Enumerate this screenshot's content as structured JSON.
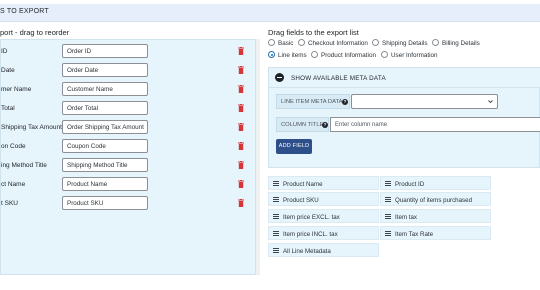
{
  "header": {
    "title": "S TO EXPORT"
  },
  "left": {
    "title": "port - drag to reorder",
    "rows": [
      {
        "label": "ID",
        "value": "Order ID"
      },
      {
        "label": "Date",
        "value": "Order Date"
      },
      {
        "label": "mer Name",
        "value": "Customer Name"
      },
      {
        "label": "Total",
        "value": "Order Total"
      },
      {
        "label": "Shipping Tax Amount",
        "value": "Order Shipping Tax Amount"
      },
      {
        "label": "on Code",
        "value": "Coupon Code"
      },
      {
        "label": "ing Method Title",
        "value": "Shipping Method Title"
      },
      {
        "label": "ct Name",
        "value": "Product Name"
      },
      {
        "label": "t SKU",
        "value": "Product SKU"
      }
    ]
  },
  "right": {
    "title": "Drag fields to the export list",
    "radios": [
      {
        "label": "Basic",
        "checked": false
      },
      {
        "label": "Checkout Information",
        "checked": false
      },
      {
        "label": "Shipping Details",
        "checked": false
      },
      {
        "label": "Billing Details",
        "checked": false
      },
      {
        "label": "Line items",
        "checked": true
      },
      {
        "label": "Product Information",
        "checked": false
      },
      {
        "label": "User Information",
        "checked": false
      }
    ],
    "meta": {
      "toggle_label": "SHOW AVAILABLE META DATA",
      "meta_label": "LINE ITEM META DATA",
      "help": "?",
      "column_label": "COLUMN TITLE",
      "column_placeholder": "Enter column name",
      "add_button": "ADD FIELD"
    },
    "fields": [
      "Product Name",
      "Product ID",
      "Product SKU",
      "Quantity of items purchased",
      "Item price EXCL. tax",
      "Item tax",
      "Item price INCL. tax",
      "Item Tax Rate",
      "All Line Metadata"
    ]
  },
  "colors": {
    "accent": "#2f4f8a",
    "panel": "#e6f4fb",
    "delete": "#d63638"
  }
}
